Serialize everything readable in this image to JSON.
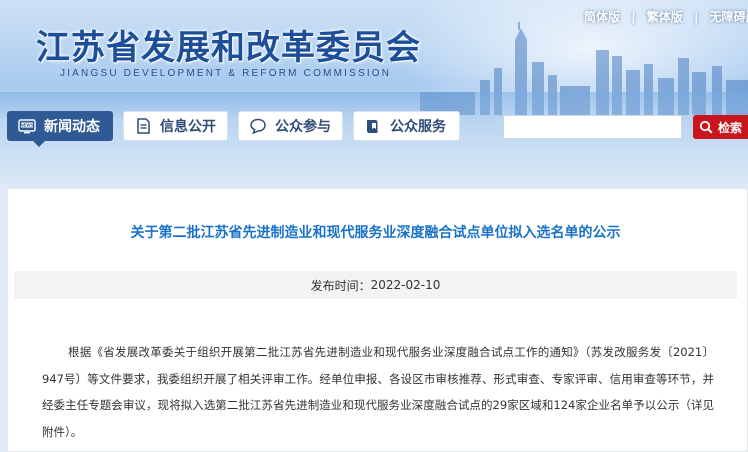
{
  "header": {
    "site_title": "江苏省发展和改革委员会",
    "site_subtitle": "JIANGSU DEVELOPMENT & REFORM COMMISSION",
    "top_links": [
      "简体版",
      "繁体版",
      "无障碍阅读"
    ],
    "link_separator": "|"
  },
  "nav": {
    "items": [
      {
        "label": "新闻动态",
        "icon": "news-icon",
        "active": true
      },
      {
        "label": "信息公开",
        "icon": "document-icon",
        "active": false
      },
      {
        "label": "公众参与",
        "icon": "chat-icon",
        "active": false
      },
      {
        "label": "公众服务",
        "icon": "book-icon",
        "active": false
      }
    ]
  },
  "search": {
    "placeholder": "",
    "button_label": "检索"
  },
  "article": {
    "title": "关于第二批江苏省先进制造业和现代服务业深度融合试点单位拟入选名单的公示",
    "publish_label": "发布时间：",
    "publish_date": "2022-02-10",
    "body": "根据《省发展改革委关于组织开展第二批江苏省先进制造业和现代服务业深度融合试点工作的通知》（苏发改服务发〔2021〕947号）等文件要求，我委组织开展了相关评审工作。经单位申报、各设区市审核推荐、形式审查、专家评审、信用审查等环节，并经委主任专题会审议，现将拟入选第二批江苏省先进制造业和现代服务业深度融合试点的29家区域和124家企业名单予以公示（详见附件）。"
  },
  "colors": {
    "brand_blue": "#1d4f98",
    "nav_active": "#2f5a95",
    "title_blue": "#1a73c9",
    "search_red": "#c9151e"
  }
}
